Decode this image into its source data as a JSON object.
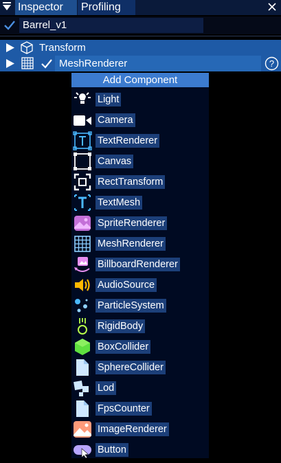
{
  "tabs": {
    "inspector": "Inspector",
    "profiling": "Profiling"
  },
  "object": {
    "name": "Barrel_v1",
    "enabled": true
  },
  "components": {
    "transform": {
      "label": "Transform"
    },
    "mesh_renderer": {
      "label": "MeshRenderer",
      "enabled": true
    }
  },
  "add_component": {
    "header": "Add Component",
    "items": [
      {
        "label": "Light",
        "icon": "light-icon"
      },
      {
        "label": "Camera",
        "icon": "camera-icon"
      },
      {
        "label": "TextRenderer",
        "icon": "text-renderer-icon"
      },
      {
        "label": "Canvas",
        "icon": "canvas-icon"
      },
      {
        "label": "RectTransform",
        "icon": "rect-transform-icon"
      },
      {
        "label": "TextMesh",
        "icon": "text-mesh-icon"
      },
      {
        "label": "SpriteRenderer",
        "icon": "sprite-renderer-icon"
      },
      {
        "label": "MeshRenderer",
        "icon": "mesh-renderer-icon"
      },
      {
        "label": "BillboardRenderer",
        "icon": "billboard-renderer-icon"
      },
      {
        "label": "AudioSource",
        "icon": "audio-source-icon"
      },
      {
        "label": "ParticleSystem",
        "icon": "particle-system-icon"
      },
      {
        "label": "RigidBody",
        "icon": "rigid-body-icon"
      },
      {
        "label": "BoxCollider",
        "icon": "box-collider-icon"
      },
      {
        "label": "SphereCollider",
        "icon": "sphere-collider-icon"
      },
      {
        "label": "Lod",
        "icon": "lod-icon"
      },
      {
        "label": "FpsCounter",
        "icon": "fps-counter-icon"
      },
      {
        "label": "ImageRenderer",
        "icon": "image-renderer-icon"
      },
      {
        "label": "Button",
        "icon": "button-icon"
      }
    ]
  },
  "colors": {
    "accent": "#1e5aa6",
    "tab_active": "#1e4f8f",
    "panel": "#000a22"
  }
}
